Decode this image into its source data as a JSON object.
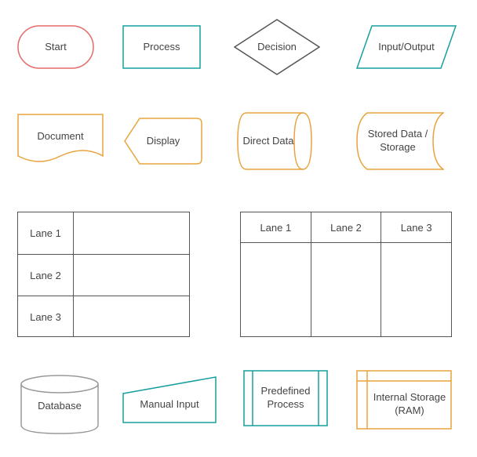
{
  "shapes": {
    "start": {
      "label": "Start",
      "stroke": "#E66A6A"
    },
    "process": {
      "label": "Process",
      "stroke": "#179E9E"
    },
    "decision": {
      "label": "Decision",
      "stroke": "#555555"
    },
    "io": {
      "label": "Input/Output",
      "stroke": "#179E9E"
    },
    "document": {
      "label": "Document",
      "stroke": "#E8A33D"
    },
    "display": {
      "label": "Display",
      "stroke": "#E8A33D"
    },
    "direct_data": {
      "label": "Direct Data",
      "stroke": "#E8A33D"
    },
    "stored_data": {
      "label": "Stored Data / Storage",
      "stroke": "#E8A33D"
    },
    "database": {
      "label": "Database",
      "stroke": "#999999"
    },
    "manual_input": {
      "label": "Manual Input",
      "stroke": "#179E9E"
    },
    "predefined": {
      "label": "Predefined Process",
      "stroke": "#179E9E"
    },
    "internal_storage": {
      "label": "Internal Storage (RAM)",
      "stroke": "#E8A33D"
    }
  },
  "swimlanes": {
    "horizontal": {
      "lanes": [
        "Lane 1",
        "Lane 2",
        "Lane 3"
      ]
    },
    "vertical": {
      "lanes": [
        "Lane 1",
        "Lane 2",
        "Lane 3"
      ]
    }
  }
}
